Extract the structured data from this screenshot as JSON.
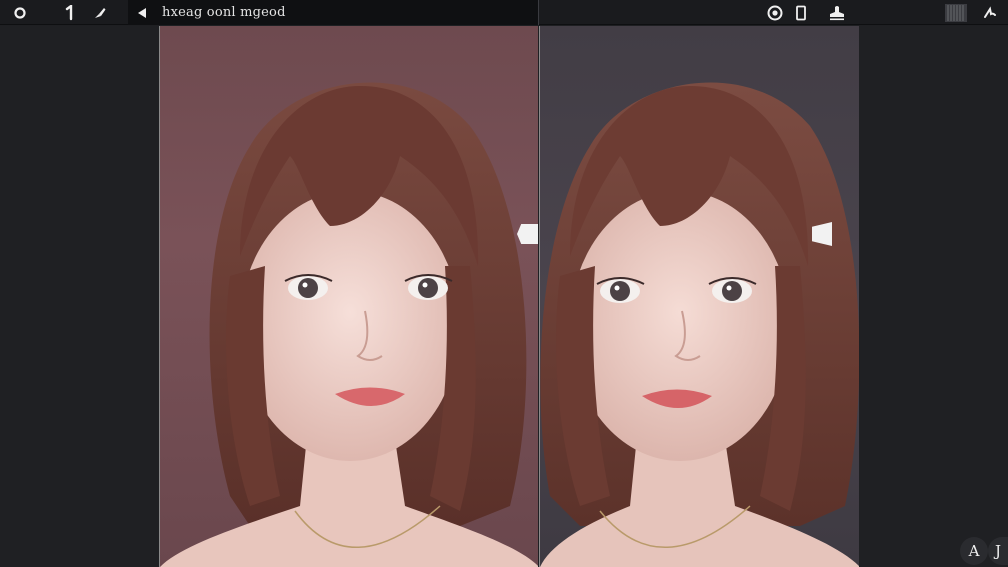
{
  "toolbar": {
    "left_tools": [
      {
        "name": "circle-tool-icon"
      },
      {
        "name": "number-one-tool-icon"
      },
      {
        "name": "brush-tool-icon"
      }
    ],
    "back_icon": "triangle-left-icon",
    "title": "hxeag oonl mgeod",
    "right_tools": [
      {
        "name": "info-circle-icon"
      },
      {
        "name": "device-frame-icon"
      },
      {
        "name": "stamp-icon"
      }
    ],
    "far_right_tools": [
      {
        "name": "grid-pattern-icon"
      },
      {
        "name": "pen-squiggle-icon"
      }
    ]
  },
  "canvases": {
    "left": {
      "background": "#74505a",
      "hair": "#6b3f36",
      "skin": "#f1d6cf",
      "lip": "#d8686c"
    },
    "right": {
      "background": "#46414a",
      "hair": "#6e4237",
      "skin": "#f0d4cd",
      "lip": "#d66468"
    }
  },
  "corner_buttons": [
    {
      "label": "A"
    },
    {
      "label": "J"
    }
  ]
}
